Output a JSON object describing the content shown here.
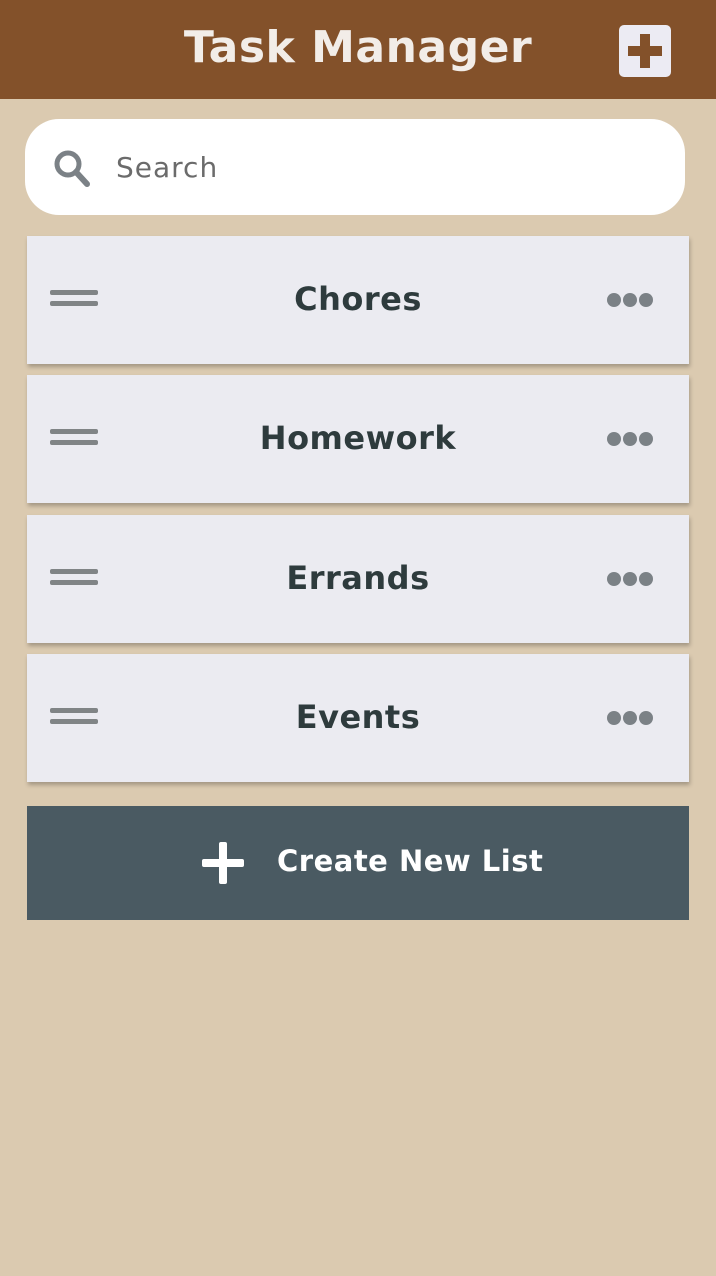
{
  "header": {
    "title": "Task Manager",
    "add_icon": "plus-square-icon"
  },
  "search": {
    "placeholder": "Search",
    "icon": "search-icon"
  },
  "lists": [
    {
      "title": "Chores"
    },
    {
      "title": "Homework"
    },
    {
      "title": "Errands"
    },
    {
      "title": "Events"
    }
  ],
  "create_button": {
    "label": "Create New List",
    "icon": "plus-icon"
  },
  "colors": {
    "header_bg": "#83512a",
    "page_bg": "#dbcab0",
    "card_bg": "#ebebf1",
    "button_bg": "#4a5a62",
    "text_dark": "#2e3b3d"
  }
}
